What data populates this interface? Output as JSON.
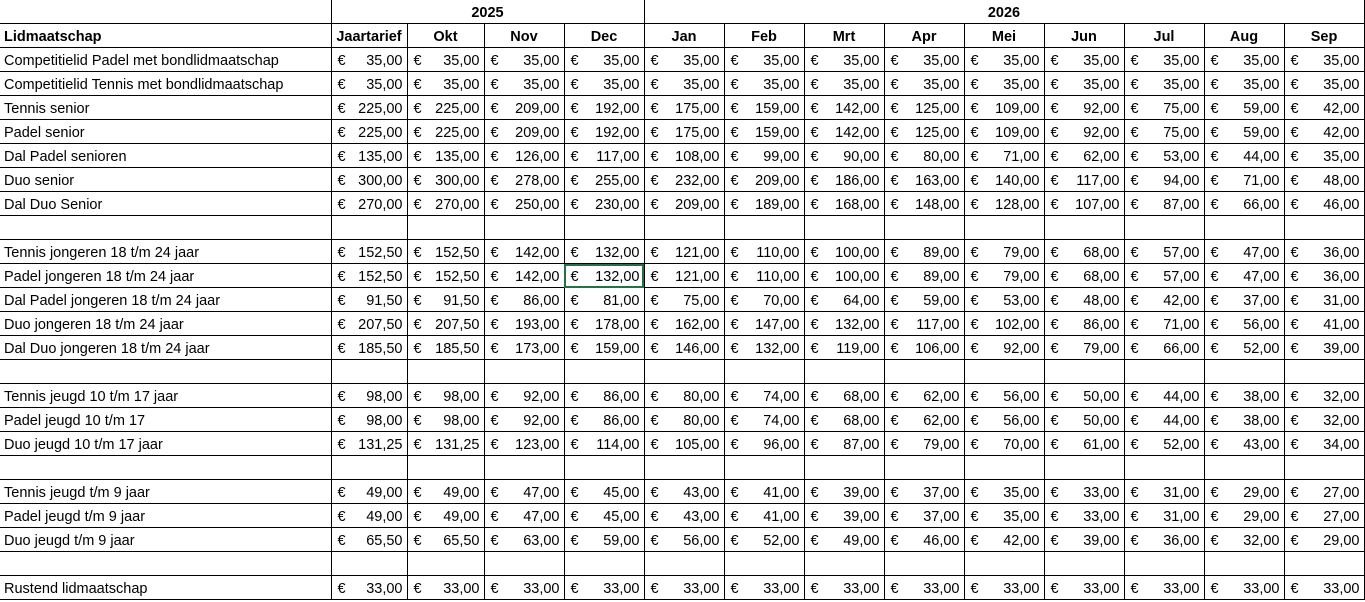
{
  "years": {
    "y2025": "2025",
    "y2026": "2026"
  },
  "headers": {
    "name": "Lidmaatschap",
    "cols": [
      "Jaartarief",
      "Okt",
      "Nov",
      "Dec",
      "Jan",
      "Feb",
      "Mrt",
      "Apr",
      "Mei",
      "Jun",
      "Jul",
      "Aug",
      "Sep"
    ]
  },
  "currency": "€",
  "rows": [
    {
      "name": "Competitielid Padel met bondlidmaatschap",
      "values": [
        "35,00",
        "35,00",
        "35,00",
        "35,00",
        "35,00",
        "35,00",
        "35,00",
        "35,00",
        "35,00",
        "35,00",
        "35,00",
        "35,00",
        "35,00"
      ]
    },
    {
      "name": "Competitielid Tennis met bondlidmaatschap",
      "values": [
        "35,00",
        "35,00",
        "35,00",
        "35,00",
        "35,00",
        "35,00",
        "35,00",
        "35,00",
        "35,00",
        "35,00",
        "35,00",
        "35,00",
        "35,00"
      ]
    },
    {
      "name": "Tennis senior",
      "values": [
        "225,00",
        "225,00",
        "209,00",
        "192,00",
        "175,00",
        "159,00",
        "142,00",
        "125,00",
        "109,00",
        "92,00",
        "75,00",
        "59,00",
        "42,00"
      ]
    },
    {
      "name": "Padel senior",
      "values": [
        "225,00",
        "225,00",
        "209,00",
        "192,00",
        "175,00",
        "159,00",
        "142,00",
        "125,00",
        "109,00",
        "92,00",
        "75,00",
        "59,00",
        "42,00"
      ]
    },
    {
      "name": "Dal Padel senioren",
      "values": [
        "135,00",
        "135,00",
        "126,00",
        "117,00",
        "108,00",
        "99,00",
        "90,00",
        "80,00",
        "71,00",
        "62,00",
        "53,00",
        "44,00",
        "35,00"
      ]
    },
    {
      "name": "Duo senior",
      "values": [
        "300,00",
        "300,00",
        "278,00",
        "255,00",
        "232,00",
        "209,00",
        "186,00",
        "163,00",
        "140,00",
        "117,00",
        "94,00",
        "71,00",
        "48,00"
      ]
    },
    {
      "name": "Dal Duo Senior",
      "values": [
        "270,00",
        "270,00",
        "250,00",
        "230,00",
        "209,00",
        "189,00",
        "168,00",
        "148,00",
        "128,00",
        "107,00",
        "87,00",
        "66,00",
        "46,00"
      ]
    },
    {
      "blank": true
    },
    {
      "name": "Tennis jongeren 18 t/m 24 jaar",
      "values": [
        "152,50",
        "152,50",
        "142,00",
        "132,00",
        "121,00",
        "110,00",
        "100,00",
        "89,00",
        "79,00",
        "68,00",
        "57,00",
        "47,00",
        "36,00"
      ]
    },
    {
      "name": "Padel jongeren 18 t/m 24 jaar",
      "values": [
        "152,50",
        "152,50",
        "142,00",
        "132,00",
        "121,00",
        "110,00",
        "100,00",
        "89,00",
        "79,00",
        "68,00",
        "57,00",
        "47,00",
        "36,00"
      ],
      "selected_col": 3
    },
    {
      "name": "Dal Padel jongeren 18 t/m 24 jaar",
      "values": [
        "91,50",
        "91,50",
        "86,00",
        "81,00",
        "75,00",
        "70,00",
        "64,00",
        "59,00",
        "53,00",
        "48,00",
        "42,00",
        "37,00",
        "31,00"
      ]
    },
    {
      "name": "Duo jongeren 18 t/m 24 jaar",
      "values": [
        "207,50",
        "207,50",
        "193,00",
        "178,00",
        "162,00",
        "147,00",
        "132,00",
        "117,00",
        "102,00",
        "86,00",
        "71,00",
        "56,00",
        "41,00"
      ]
    },
    {
      "name": "Dal Duo jongeren 18 t/m 24 jaar",
      "values": [
        "185,50",
        "185,50",
        "173,00",
        "159,00",
        "146,00",
        "132,00",
        "119,00",
        "106,00",
        "92,00",
        "79,00",
        "66,00",
        "52,00",
        "39,00"
      ]
    },
    {
      "blank": true
    },
    {
      "name": "Tennis jeugd 10 t/m 17 jaar",
      "values": [
        "98,00",
        "98,00",
        "92,00",
        "86,00",
        "80,00",
        "74,00",
        "68,00",
        "62,00",
        "56,00",
        "50,00",
        "44,00",
        "38,00",
        "32,00"
      ]
    },
    {
      "name": "Padel jeugd 10 t/m 17",
      "values": [
        "98,00",
        "98,00",
        "92,00",
        "86,00",
        "80,00",
        "74,00",
        "68,00",
        "62,00",
        "56,00",
        "50,00",
        "44,00",
        "38,00",
        "32,00"
      ]
    },
    {
      "name": "Duo jeugd 10 t/m 17 jaar",
      "values": [
        "131,25",
        "131,25",
        "123,00",
        "114,00",
        "105,00",
        "96,00",
        "87,00",
        "79,00",
        "70,00",
        "61,00",
        "52,00",
        "43,00",
        "34,00"
      ]
    },
    {
      "blank": true
    },
    {
      "name": "Tennis jeugd t/m 9 jaar",
      "values": [
        "49,00",
        "49,00",
        "47,00",
        "45,00",
        "43,00",
        "41,00",
        "39,00",
        "37,00",
        "35,00",
        "33,00",
        "31,00",
        "29,00",
        "27,00"
      ]
    },
    {
      "name": "Padel jeugd t/m 9 jaar",
      "values": [
        "49,00",
        "49,00",
        "47,00",
        "45,00",
        "43,00",
        "41,00",
        "39,00",
        "37,00",
        "35,00",
        "33,00",
        "31,00",
        "29,00",
        "27,00"
      ]
    },
    {
      "name": "Duo jeugd t/m 9 jaar",
      "values": [
        "65,50",
        "65,50",
        "63,00",
        "59,00",
        "56,00",
        "52,00",
        "49,00",
        "46,00",
        "42,00",
        "39,00",
        "36,00",
        "32,00",
        "29,00"
      ]
    },
    {
      "blank": true
    },
    {
      "name": "Rustend lidmaatschap",
      "values": [
        "33,00",
        "33,00",
        "33,00",
        "33,00",
        "33,00",
        "33,00",
        "33,00",
        "33,00",
        "33,00",
        "33,00",
        "33,00",
        "33,00",
        "33,00"
      ]
    }
  ]
}
